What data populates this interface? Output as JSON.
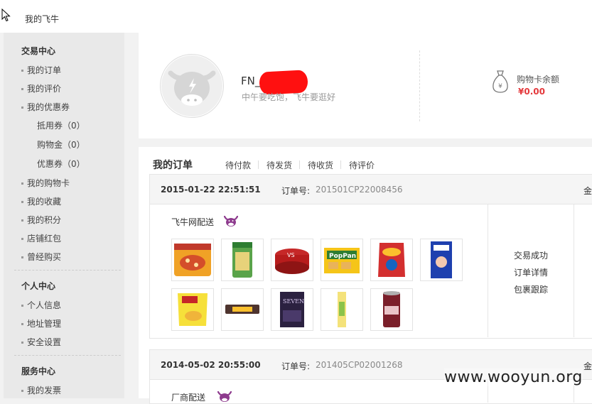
{
  "breadcrumb": "我的飞牛",
  "sidebar": {
    "trade_title": "交易中心",
    "trade_items": [
      "我的订单",
      "我的评价",
      "我的优惠券"
    ],
    "coupon_subitems": [
      "抵用券（0）",
      "购物金（0）",
      "优惠券（0）"
    ],
    "trade_items2": [
      "我的购物卡",
      "我的收藏",
      "我的积分",
      "店铺红包",
      "曾经购买"
    ],
    "personal_title": "个人中心",
    "personal_items": [
      "个人信息",
      "地址管理",
      "安全设置"
    ],
    "service_title": "服务中心",
    "service_items": [
      "我的发票"
    ]
  },
  "profile": {
    "username": "FN_",
    "motto": "中午要吃饱，飞牛要逛好",
    "card_label": "购物卡余额",
    "card_value": "¥0.00"
  },
  "orders": {
    "title": "我的订单",
    "tabs": [
      "待付款",
      "待发货",
      "待收货",
      "待评价"
    ],
    "list": [
      {
        "date": "2015-01-22 22:51:51",
        "order_no_label": "订单号:",
        "order_no": "201501CP22008456",
        "head_trunc": "金",
        "ship": "飞牛网配送",
        "actions": [
          "交易成功",
          "订单详情",
          "包裹跟踪"
        ]
      },
      {
        "date": "2014-05-02 20:55:00",
        "order_no_label": "订单号:",
        "order_no": "201405CP02001268",
        "head_trunc": "金",
        "ship": "厂商配送"
      }
    ]
  },
  "watermark": "www.wooyun.org",
  "colors": {
    "price_red": "#e4393c",
    "cow_purple": "#8e3b8e"
  }
}
